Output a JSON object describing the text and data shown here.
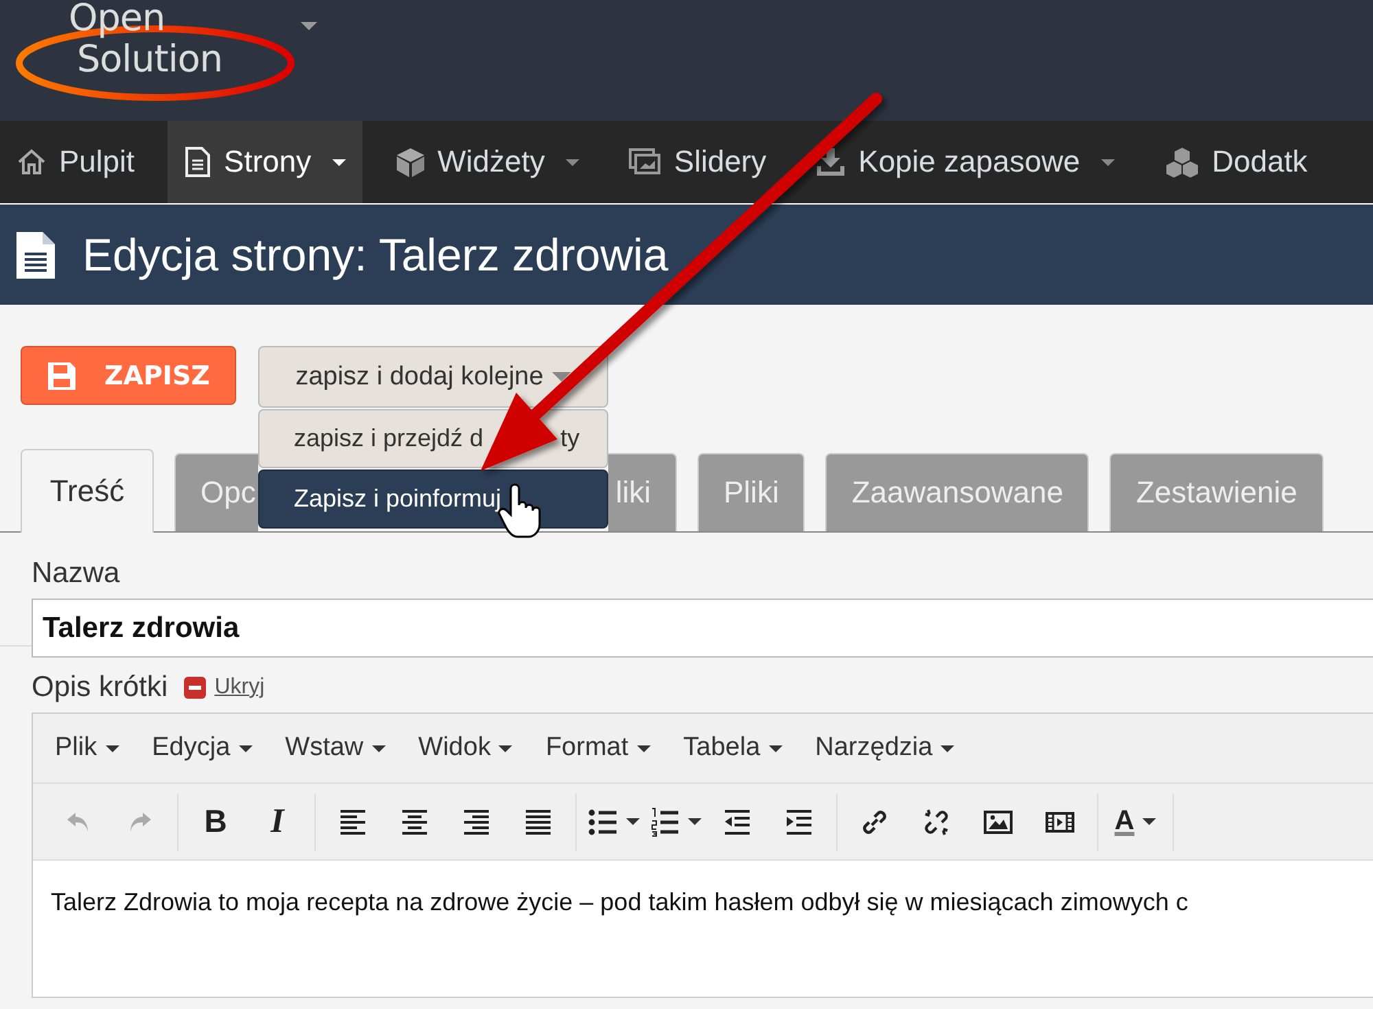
{
  "logo": {
    "line_1": "Open",
    "line_2": "Solution",
    "menu": true
  },
  "nav": [
    {
      "label": "Pulpit",
      "selected": false,
      "dropdown": false
    },
    {
      "label": "Strony",
      "selected": true,
      "dropdown": true
    },
    {
      "label": "Widżety",
      "selected": false,
      "dropdown": true
    },
    {
      "label": "Slidery",
      "selected": false,
      "dropdown": false
    },
    {
      "label": "Kopie zapasowe",
      "selected": false,
      "dropdown": true
    },
    {
      "label": "Dodatk",
      "selected": false,
      "dropdown": false
    }
  ],
  "page_title": "Edycja strony: Talerz zdrowia",
  "actions": {
    "save": "ZAPISZ",
    "split_button": "zapisz i dodaj kolejne",
    "menu": [
      {
        "label": "zapisz i przejdź d",
        "label_end": "ty",
        "selected": false
      },
      {
        "label": "Zapisz i poinformuj",
        "selected": true
      }
    ]
  },
  "tabs": [
    {
      "label": "Treść",
      "selected": true
    },
    {
      "label": "Opc",
      "selected": false
    },
    {
      "label": "liki",
      "selected": false
    },
    {
      "label": "Pliki",
      "selected": false
    },
    {
      "label": "Zaawansowane",
      "selected": false
    },
    {
      "label": "Zestawienie",
      "selected": false
    }
  ],
  "name_field": {
    "label": "Nazwa",
    "value": "Talerz zdrowia"
  },
  "short_description": {
    "label": "Opis krótki",
    "toggle": "Ukryj",
    "menu": [
      "Plik",
      "Edycja",
      "Wstaw",
      "Widok",
      "Format",
      "Tabela",
      "Narzędzia"
    ],
    "toolbar": [
      [
        {
          "kind": "icon",
          "disabled": true
        },
        {
          "kind": "icon",
          "disabled": true
        }
      ],
      [
        {
          "kind": "glyph",
          "label": "B",
          "disabled": false
        },
        {
          "kind": "glyph",
          "label": "I",
          "disabled": false
        }
      ],
      [
        {
          "kind": "icon",
          "disabled": false
        },
        {
          "kind": "icon",
          "disabled": false
        },
        {
          "kind": "icon",
          "disabled": false
        },
        {
          "kind": "icon",
          "disabled": false
        }
      ],
      [
        {
          "kind": "icon",
          "disabled": false,
          "dropdown": true
        },
        {
          "kind": "icon",
          "disabled": false,
          "dropdown": true
        },
        {
          "kind": "icon",
          "disabled": false
        },
        {
          "kind": "icon",
          "disabled": false
        }
      ],
      [
        {
          "kind": "icon",
          "disabled": false
        },
        {
          "kind": "icon",
          "disabled": false
        },
        {
          "kind": "icon",
          "disabled": false
        },
        {
          "kind": "icon",
          "disabled": false
        }
      ],
      [
        {
          "kind": "glyph",
          "label": "A",
          "disabled": false,
          "dropdown": true
        }
      ]
    ],
    "content": "Talerz Zdrowia to moja recepta na zdrowe życie – pod takim hasłem odbył się w miesiącach zimowych c"
  }
}
